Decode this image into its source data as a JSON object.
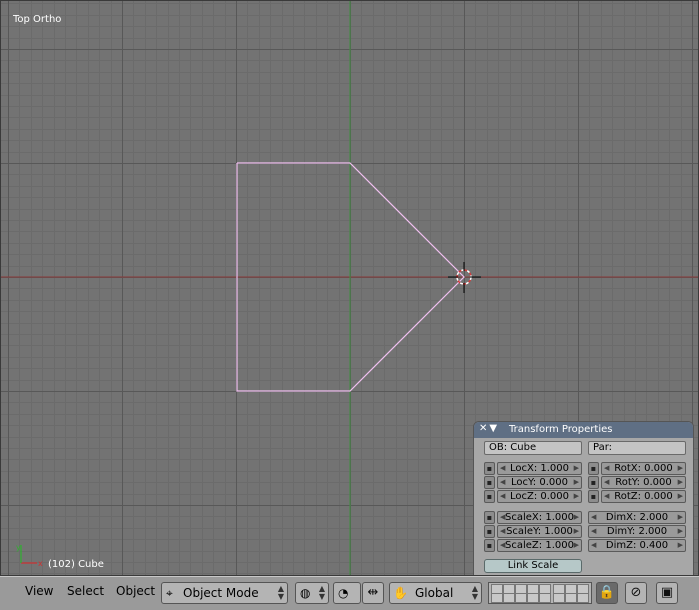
{
  "viewport": {
    "view_label": "Top Ortho",
    "object_label": "(102) Cube",
    "colors": {
      "background": "#737373",
      "grid_minor": "#6b6b6b",
      "grid_major": "#585858",
      "x_axis": "#8a3a3a",
      "y_axis": "#3f8f3f",
      "selected_outline": "#f0c0f0",
      "cursor": "#000000",
      "cursor_ring": "#d23a3a"
    },
    "axis_widget": {
      "x_color": "#d03030",
      "y_color": "#30b030"
    }
  },
  "transform_panel": {
    "title": "Transform Properties",
    "header_icons": "✕▼",
    "ob_field": "OB: Cube",
    "par_field": "Par:",
    "loc": [
      {
        "label": "LocX: 1.000"
      },
      {
        "label": "LocY: 0.000"
      },
      {
        "label": "LocZ: 0.000"
      }
    ],
    "rot": [
      {
        "label": "RotX: 0.000"
      },
      {
        "label": "RotY: 0.000"
      },
      {
        "label": "RotZ: 0.000"
      }
    ],
    "scale": [
      {
        "label": "ScaleX: 1.000"
      },
      {
        "label": "ScaleY: 1.000"
      },
      {
        "label": "ScaleZ: 1.000"
      }
    ],
    "dim": [
      {
        "label": "DimX: 2.000"
      },
      {
        "label": "DimY: 2.000"
      },
      {
        "label": "DimZ: 0.400"
      }
    ],
    "link_scale_label": "Link Scale"
  },
  "toolbar": {
    "menus": [
      "View",
      "Select",
      "Object"
    ],
    "mode": "Object Mode",
    "orientation": "Global",
    "icons": {
      "mode": "object-mode-icon",
      "shading": "viewport-shading-icon",
      "pivot": "pivot-point-icon",
      "snap": "snap-icon",
      "manipulator": "hand-manipulator-icon",
      "lock": "lock-icon",
      "link": "link-icon",
      "render": "render-icon"
    }
  }
}
